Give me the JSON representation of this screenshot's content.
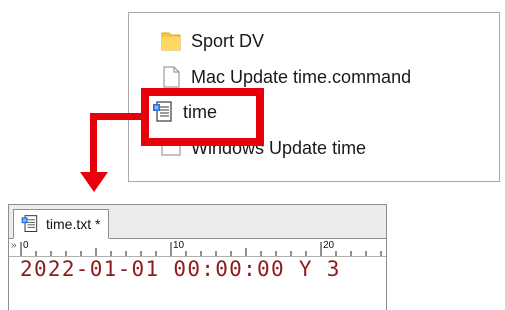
{
  "explorer": {
    "items": [
      {
        "label": "Sport DV",
        "icon": "folder-icon"
      },
      {
        "label": "Mac Update time.command",
        "icon": "blank-document-icon"
      },
      {
        "label": "time",
        "icon": "text-document-icon"
      },
      {
        "label": "Windows Update time",
        "icon": "shortcut-icon"
      }
    ]
  },
  "editor": {
    "tab_label": "time.txt *",
    "ruler_marks": [
      "0",
      "10",
      "20"
    ],
    "content_line": "2022-01-01 00:00:00 Y 3"
  },
  "colors": {
    "highlight": "#e8000b",
    "text_content": "#8f1c1c",
    "folder": "#f6c945"
  }
}
